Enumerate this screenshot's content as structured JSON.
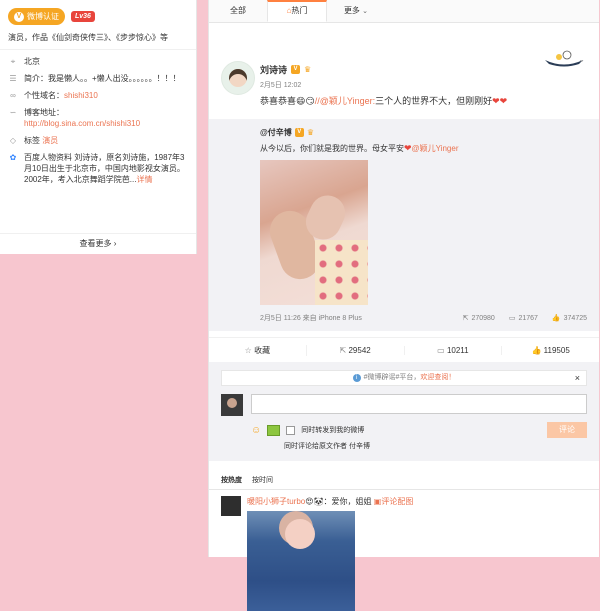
{
  "profile": {
    "verify_label": "微博认证",
    "level": "Lv36",
    "intro": "演员，作品《仙剑奇侠传三》、《步步惊心》等",
    "rows": [
      {
        "icon": "location-icon",
        "text": "北京"
      },
      {
        "icon": "profile-icon",
        "text": "简介：我是懒人。。+懒人出没。。。。。。！！！"
      },
      {
        "icon": "link-icon",
        "label": "个性域名：",
        "value": "shishi310"
      },
      {
        "icon": "blog-icon",
        "label": "博客地址：",
        "value": "http://blog.sina.com.cn/shishi310"
      },
      {
        "icon": "tag-icon",
        "label": "标签 ",
        "value": "演员"
      },
      {
        "icon": "paw-icon",
        "text": "百度人物资料 刘诗诗，原名刘诗施，1987年3月10日出生于北京市，中国内地影视女演员。2002年，考入北京舞蹈学院芭...",
        "more": "详情"
      }
    ],
    "view_more": "查看更多 ›"
  },
  "tabs": [
    {
      "label": "全部"
    },
    {
      "label": "热门",
      "icon": "flame-icon"
    },
    {
      "label": "更多",
      "caret": "⌄"
    }
  ],
  "post": {
    "author": "刘诗诗",
    "time": "2月5日 12:02",
    "text_start": "恭喜恭喜",
    "text_link": "//@颖儿Yinger:",
    "text_end": "三个人的世界不大，但刚刚好",
    "repost": {
      "author": "@付辛博",
      "text_start": "从今以后，你们就是我的世界。母女平安",
      "text_link": "@颖儿Yinger",
      "meta": "2月5日 11:26 来自 iPhone 8 Plus",
      "reposts": "270980",
      "comments": "21767",
      "likes": "374725"
    },
    "actions": {
      "collect": "收藏",
      "repost": "29542",
      "comment": "10211",
      "like": "119505"
    },
    "notice": "#微博辟谣#平台，",
    "notice_link": "欢迎查阅！",
    "notice_close": "×",
    "comment_placeholder": "",
    "also_repost": "同时转发到我的微博",
    "also_comment_author": "同时评论给原文作者 付辛博",
    "submit": "评论",
    "sort_hot": "按热度",
    "sort_time": "按时间",
    "comment": {
      "name": "暖阳小狮子turbo",
      "text": "：爱你，姐姐",
      "link": "评论配图"
    }
  }
}
